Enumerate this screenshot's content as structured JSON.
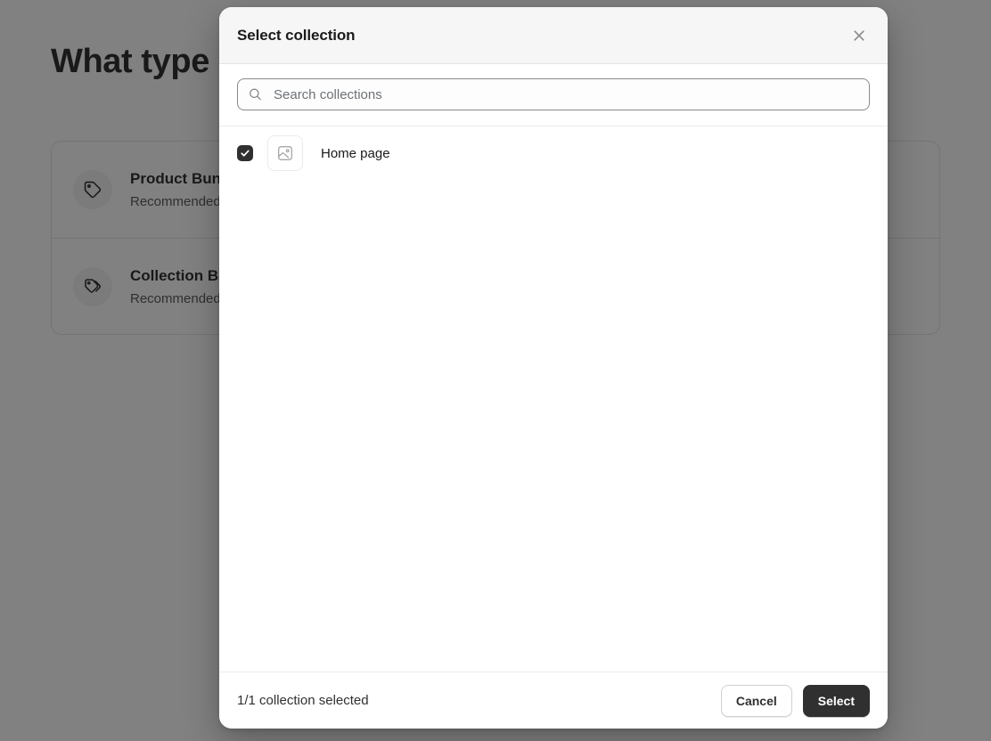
{
  "background": {
    "heading": "What type of bundle?",
    "cards": [
      {
        "title": "Product Bundle",
        "subtitle": "Recommended for products",
        "icon": "tag-icon"
      },
      {
        "title": "Collection Bundle",
        "subtitle": "Recommended for collections",
        "icon": "tags-icon"
      }
    ]
  },
  "modal": {
    "title": "Select collection",
    "close_icon": "close-icon",
    "search": {
      "placeholder": "Search collections",
      "value": "",
      "icon": "search-icon"
    },
    "collections": [
      {
        "label": "Home page",
        "checked": true,
        "thumb_icon": "image-placeholder-icon"
      }
    ],
    "footer": {
      "status": "1/1 collection selected",
      "cancel_label": "Cancel",
      "select_label": "Select"
    }
  },
  "colors": {
    "accent": "#303030",
    "backdrop": "#7a7a7a",
    "header_bg": "#f6f6f7",
    "border": "#e3e3e3"
  }
}
